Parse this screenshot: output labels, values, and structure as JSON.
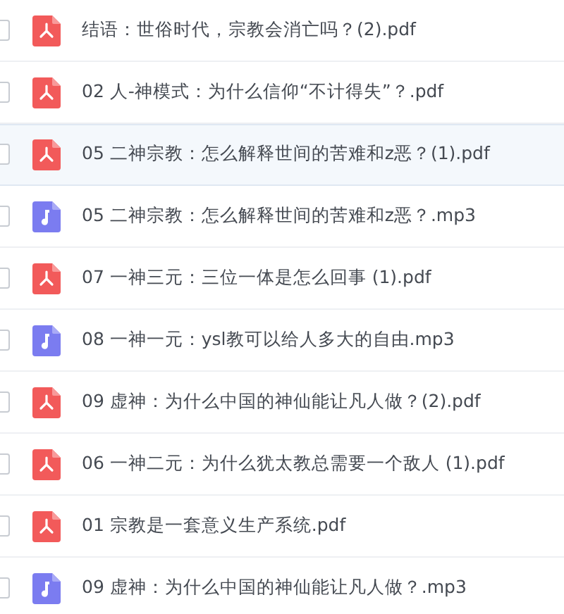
{
  "files": [
    {
      "name": "结语：世俗时代，宗教会消亡吗？(2).pdf",
      "kind": "pdf",
      "selected": false,
      "checked": false
    },
    {
      "name": "02 人-神模式：为什么信仰“不计得失”？.pdf",
      "kind": "pdf",
      "selected": false,
      "checked": false
    },
    {
      "name": "05 二神宗教：怎么解释世间的苦难和z恶？(1).pdf",
      "kind": "pdf",
      "selected": true,
      "checked": false
    },
    {
      "name": "05 二神宗教：怎么解释世间的苦难和z恶？.mp3",
      "kind": "audio",
      "selected": false,
      "checked": false
    },
    {
      "name": "07 一神三元：三位一体是怎么回事 (1).pdf",
      "kind": "pdf",
      "selected": false,
      "checked": false
    },
    {
      "name": "08 一神一元：ysl教可以给人多大的自由.mp3",
      "kind": "audio",
      "selected": false,
      "checked": false
    },
    {
      "name": "09 虚神：为什么中国的神仙能让凡人做？(2).pdf",
      "kind": "pdf",
      "selected": false,
      "checked": false
    },
    {
      "name": "06 一神二元：为什么犹太教总需要一个敌人 (1).pdf",
      "kind": "pdf",
      "selected": false,
      "checked": false
    },
    {
      "name": "01 宗教是一套意义生产系统.pdf",
      "kind": "pdf",
      "selected": false,
      "checked": false
    },
    {
      "name": "09 虚神：为什么中国的神仙能让凡人做？.mp3",
      "kind": "audio",
      "selected": false,
      "checked": false
    }
  ]
}
